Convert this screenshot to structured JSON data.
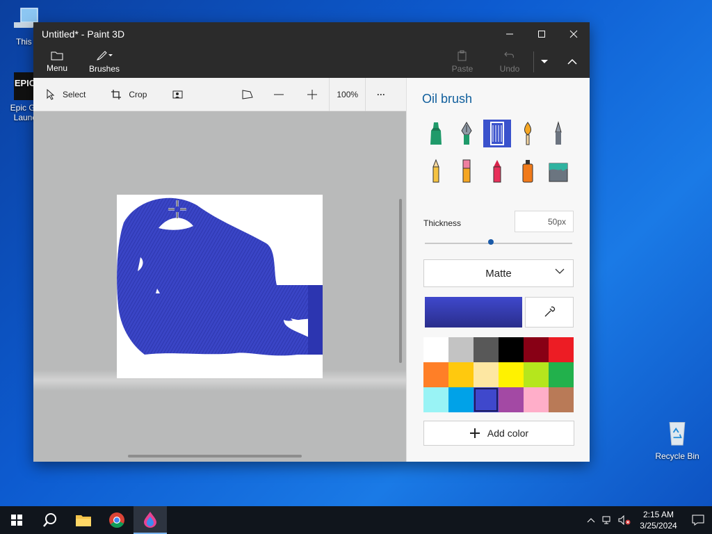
{
  "desktop": {
    "this_pc_label": "This P",
    "epic_label_line1": "Epic Ga",
    "epic_label_line2": "Launc",
    "epic_logo_text": "EPIC",
    "recycle_label": "Recycle Bin"
  },
  "window": {
    "title": "Untitled* - Paint 3D"
  },
  "ribbon": {
    "menu_label": "Menu",
    "brushes_label": "Brushes",
    "paste_label": "Paste",
    "undo_label": "Undo"
  },
  "toolbar": {
    "select_label": "Select",
    "crop_label": "Crop",
    "zoom_label": "100%",
    "more_label": "···"
  },
  "panel": {
    "title": "Oil brush",
    "brushes": [
      "marker",
      "calligraphy-pen",
      "oil-brush",
      "watercolor",
      "pixel-pen",
      "pencil",
      "eraser",
      "crayon",
      "spray-can",
      "fill"
    ],
    "selected_brush": "oil-brush",
    "thickness_label": "Thickness",
    "thickness_value": "50px",
    "thickness_level_percent": 45,
    "finish_value": "Matte",
    "current_color": "#3f48cc",
    "palette": [
      "#ffffff",
      "#c3c3c3",
      "#585858",
      "#000000",
      "#880015",
      "#ed1c24",
      "#ff7f27",
      "#ffc90e",
      "#fde7a2",
      "#fff200",
      "#b5e61d",
      "#22b14c",
      "#99f3f5",
      "#00a2e8",
      "#3f48cc",
      "#a349a4",
      "#ffaec9",
      "#b97a57"
    ],
    "selected_swatch": 14,
    "add_color_label": "Add color"
  },
  "taskbar": {
    "time": "2:15 AM",
    "date": "3/25/2024"
  }
}
